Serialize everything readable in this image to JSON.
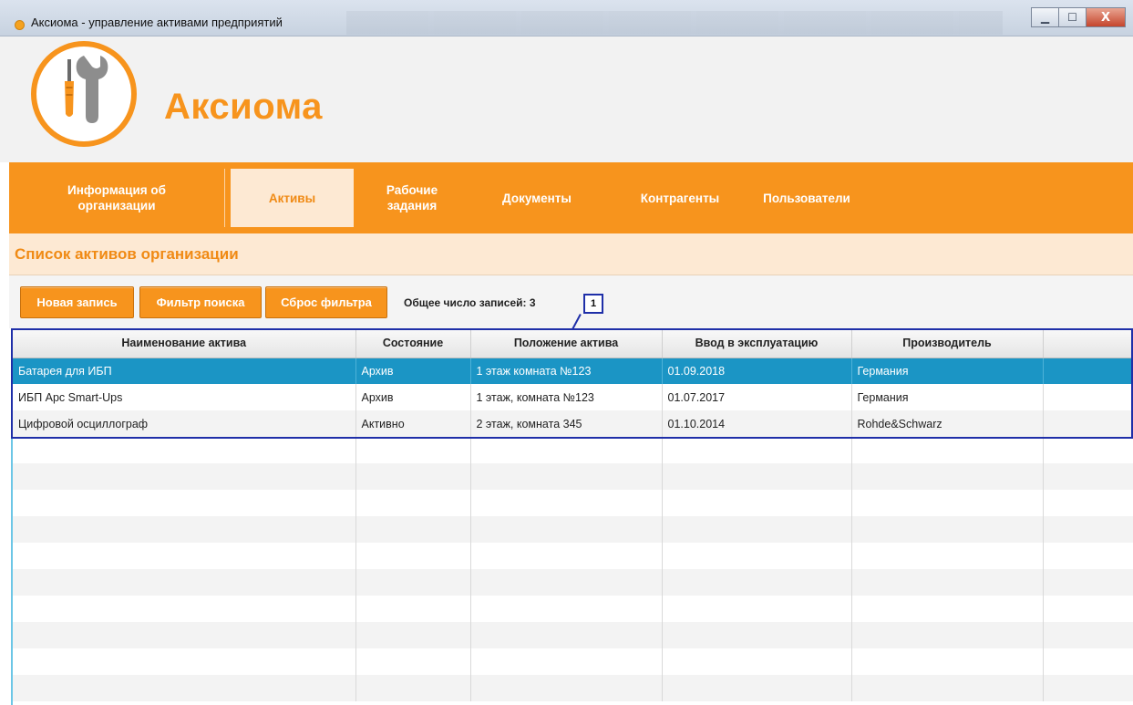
{
  "window": {
    "title": "Аксиома - управление активами предприятий",
    "minimize_icon": "minimize-icon",
    "maximize_icon": "maximize-icon",
    "close_icon": "close-icon",
    "minimize_glyph": "▁",
    "maximize_glyph": "☐",
    "close_glyph": "X"
  },
  "app": {
    "name": "Аксиома",
    "logo_icon": "tools-icon",
    "brand_color": "#f7941d"
  },
  "nav": {
    "items": [
      {
        "label": "Информация об\nорганизации",
        "active": false
      },
      {
        "label": "Активы",
        "active": true
      },
      {
        "label": "Рабочие\nзадания",
        "active": false
      },
      {
        "label": "Документы",
        "active": false
      },
      {
        "label": "Контрагенты",
        "active": false
      },
      {
        "label": "Пользователи",
        "active": false
      }
    ]
  },
  "page": {
    "title": "Список активов организации"
  },
  "toolbar": {
    "new_record": "Новая запись",
    "search_filter": "Фильтр поиска",
    "reset_filter": "Сброс фильтра",
    "record_count": "Общее число записей: 3"
  },
  "annotation": {
    "label": "1",
    "color": "#1f2fa8"
  },
  "table": {
    "columns": [
      "Наименование актива",
      "Состояние",
      "Положение актива",
      "Ввод в эксплуатацию",
      "Производитель",
      ""
    ],
    "rows": [
      {
        "name": "Батарея для ИБП",
        "state": "Архив",
        "location": "1 этаж комната №123",
        "commissioned": "01.09.2018",
        "manufacturer": "Германия",
        "selected": true
      },
      {
        "name": "ИБП Apc Smart-Ups",
        "state": "Архив",
        "location": "1 этаж, комната №123",
        "commissioned": "01.07.2017",
        "manufacturer": "Германия",
        "selected": false
      },
      {
        "name": "Цифровой осциллограф",
        "state": "Активно",
        "location": "2 этаж, комната 345",
        "commissioned": "01.10.2014",
        "manufacturer": "Rohde&Schwarz",
        "selected": false
      }
    ],
    "selected_color": "#1b95c5"
  }
}
